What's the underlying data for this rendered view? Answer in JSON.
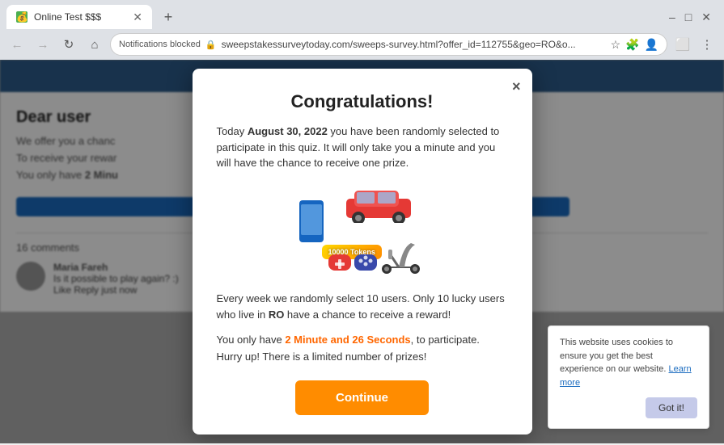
{
  "browser": {
    "tab": {
      "title": "Online Test $$$",
      "favicon": "💰"
    },
    "address": {
      "notifications_blocked": "Notifications blocked",
      "url": "sweepstakessurveytoday.com/sweeps-survey.html?offer_id=112755&geo=RO&o...",
      "lock_icon": "🔒"
    }
  },
  "page": {
    "header_text": "Congratulations!"
  },
  "background": {
    "title": "Dear user",
    "line1": "We offer you a chanc",
    "line2": "To receive your rewar",
    "line3": "You only have",
    "bold3": "2 Minu",
    "btn_label": "",
    "comments_label": "16 comments",
    "comment": {
      "name": "Maria Fareh",
      "text": "Is it possible to play again? :)",
      "meta": "Like  Reply   just now"
    }
  },
  "modal": {
    "title": "Congratulations!",
    "close_label": "×",
    "intro_pre": "Today ",
    "intro_date": "August 30, 2022",
    "intro_post": " you have been randomly selected to participate in this quiz. It will only take you a minute and you will have the chance to receive one prize.",
    "weekly_text": "Every week we randomly select 10 users. Only 10 lucky users who live in ",
    "weekly_country": "RO",
    "weekly_post": " have a chance to receive a reward!",
    "timer_pre": "You only have ",
    "timer_value": "2 Minute and 26 Seconds",
    "timer_post": ", to participate.",
    "hurry": "Hurry up! There is a limited number of prizes!",
    "continue_label": "Continue",
    "prizes_label": "10000 Tokens"
  },
  "cookie": {
    "text": "This website uses cookies to ensure you get the best experience on our website.",
    "link_text": "Learn more",
    "button_label": "Got it!"
  }
}
